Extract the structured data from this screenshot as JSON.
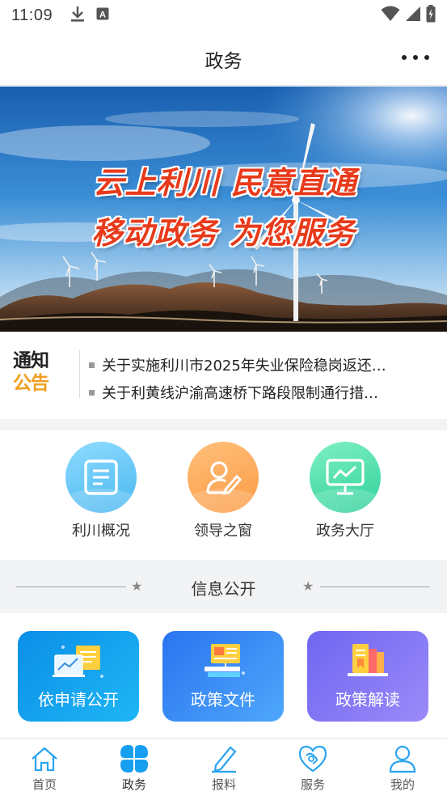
{
  "status_bar": {
    "time": "11:09",
    "icons_left": [
      "download-icon",
      "a-box-icon"
    ],
    "icons_right": [
      "wifi-icon",
      "signal-icon",
      "battery-icon"
    ]
  },
  "header": {
    "title": "政务",
    "more_icon": "more-dots-icon"
  },
  "banner": {
    "line1": "云上利川 民意直通",
    "line2": "移动政务 为您服务"
  },
  "notice": {
    "logo_line1": "通知",
    "logo_line2": "公告",
    "items": [
      "关于实施利川市2025年失业保险稳岗返还…",
      "关于利黄线沪渝高速桥下路段限制通行措…"
    ]
  },
  "entries": [
    {
      "label": "利川概况",
      "icon": "document-list-icon"
    },
    {
      "label": "领导之窗",
      "icon": "person-pen-icon"
    },
    {
      "label": "政务大厅",
      "icon": "monitor-chart-icon"
    }
  ],
  "section": {
    "title": "信息公开"
  },
  "cards": [
    {
      "label": "依申请公开",
      "icon": "chart-documents-icon"
    },
    {
      "label": "政策文件",
      "icon": "presentation-books-icon"
    },
    {
      "label": "政策解读",
      "icon": "books-stack-icon"
    }
  ],
  "tabbar": {
    "items": [
      {
        "label": "首页",
        "icon": "home-icon",
        "active": false
      },
      {
        "label": "政务",
        "icon": "clover-icon",
        "active": true
      },
      {
        "label": "报料",
        "icon": "pencil-icon",
        "active": false
      },
      {
        "label": "服务",
        "icon": "heart-service-icon",
        "active": false
      },
      {
        "label": "我的",
        "icon": "user-icon",
        "active": false
      }
    ]
  },
  "colors": {
    "accent": "#1aa0f0",
    "banner_text": "#e83a1a",
    "notice_orange": "#f0a020"
  }
}
